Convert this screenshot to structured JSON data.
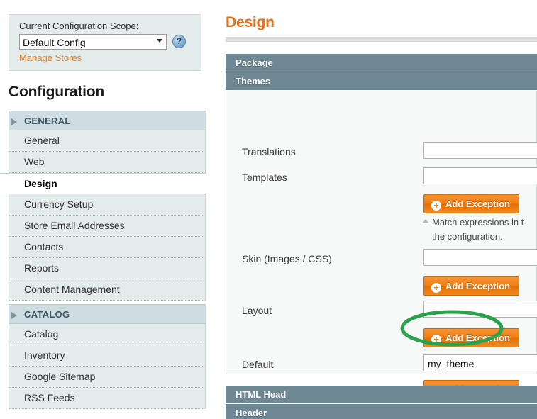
{
  "scope": {
    "label": "Current Configuration Scope:",
    "selected": "Default Config",
    "help_icon": "question-mark-icon",
    "manage_stores_link": "Manage Stores",
    "caret_icon": "chevron-down-icon"
  },
  "sidebar": {
    "title": "Configuration",
    "sections": [
      {
        "label": "GENERAL",
        "arrow_icon": "triangle-right-icon",
        "items": [
          {
            "label": "General",
            "active": false
          },
          {
            "label": "Web",
            "active": false
          },
          {
            "label": "Design",
            "active": true
          },
          {
            "label": "Currency Setup",
            "active": false
          },
          {
            "label": "Store Email Addresses",
            "active": false
          },
          {
            "label": "Contacts",
            "active": false
          },
          {
            "label": "Reports",
            "active": false
          },
          {
            "label": "Content Management",
            "active": false
          }
        ]
      },
      {
        "label": "CATALOG",
        "arrow_icon": "triangle-right-icon",
        "items": [
          {
            "label": "Catalog",
            "active": false
          },
          {
            "label": "Inventory",
            "active": false
          },
          {
            "label": "Google Sitemap",
            "active": false
          },
          {
            "label": "RSS Feeds",
            "active": false
          }
        ]
      }
    ]
  },
  "main": {
    "page_title": "Design",
    "section_bars": [
      {
        "label": "Package"
      },
      {
        "label": "Themes"
      }
    ],
    "fields": [
      {
        "label": "Translations",
        "value": ""
      },
      {
        "label": "Templates",
        "value": ""
      },
      {
        "label": "Skin (Images / CSS)",
        "value": ""
      },
      {
        "label": "Layout",
        "value": ""
      },
      {
        "label": "Default",
        "value": "my_theme"
      }
    ],
    "add_exception_label": "Add Exception",
    "add_exception_icon": "plus-circle-icon",
    "hint": {
      "icon": "triangle-up-icon",
      "line1": "Match expressions in t",
      "line2": "the configuration."
    },
    "bottom_bars": [
      {
        "label": "HTML Head"
      },
      {
        "label": "Header"
      }
    ]
  },
  "annotation": {
    "shape": "ellipse",
    "target": "my_theme",
    "color": "#2ba24c"
  },
  "colors": {
    "accent_orange": "#ea6f15",
    "section_bar": "#6e8894",
    "sidebar_item_bg": "#e3ebeb",
    "sidebar_section_bg": "#cfdde2",
    "annotation_green": "#2ba24c"
  }
}
